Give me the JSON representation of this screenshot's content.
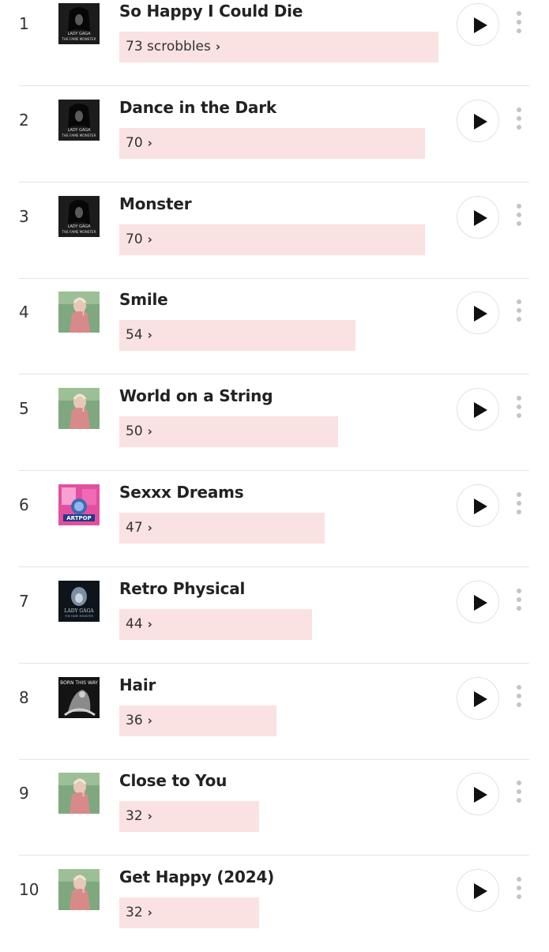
{
  "tracks": [
    {
      "rank": "1",
      "title": "So Happy I Could Die",
      "scrobbles": "73 scrobbles",
      "scrobble_value": 73,
      "art": "fame-monster"
    },
    {
      "rank": "2",
      "title": "Dance in the Dark",
      "scrobbles": "70",
      "scrobble_value": 70,
      "art": "fame-monster"
    },
    {
      "rank": "3",
      "title": "Monster",
      "scrobbles": "70",
      "scrobble_value": 70,
      "art": "fame-monster"
    },
    {
      "rank": "4",
      "title": "Smile",
      "scrobbles": "54",
      "scrobble_value": 54,
      "art": "green-portrait"
    },
    {
      "rank": "5",
      "title": "World on a String",
      "scrobbles": "50",
      "scrobble_value": 50,
      "art": "green-portrait"
    },
    {
      "rank": "6",
      "title": "Sexxx Dreams",
      "scrobbles": "47",
      "scrobble_value": 47,
      "art": "artpop"
    },
    {
      "rank": "7",
      "title": "Retro Physical",
      "scrobbles": "44",
      "scrobble_value": 44,
      "art": "fame-dark"
    },
    {
      "rank": "8",
      "title": "Hair",
      "scrobbles": "36",
      "scrobble_value": 36,
      "art": "born-this-way"
    },
    {
      "rank": "9",
      "title": "Close to You",
      "scrobbles": "32",
      "scrobble_value": 32,
      "art": "green-portrait"
    },
    {
      "rank": "10",
      "title": "Get Happy (2024)",
      "scrobbles": "32",
      "scrobble_value": 32,
      "art": "green-portrait"
    }
  ],
  "icons": {
    "play": "play-icon",
    "more": "more-options-icon",
    "chevron": "chevron-right-icon"
  },
  "colors": {
    "bar": "#f9e2e1",
    "divider": "#e4e4e4",
    "text": "#222222"
  }
}
